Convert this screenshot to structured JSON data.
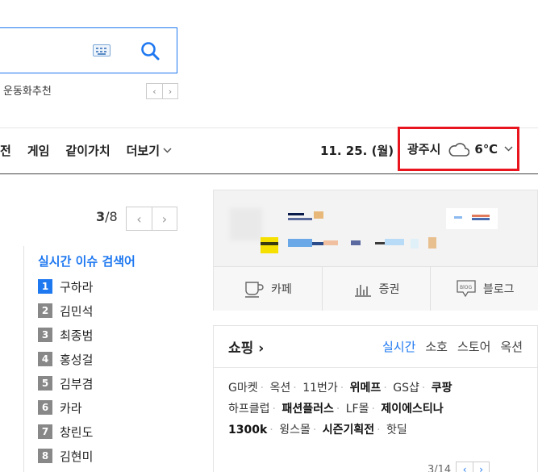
{
  "search": {
    "keyboard_icon": "keyboard-icon",
    "search_icon": "search-icon",
    "suggest_label": "운동화추천"
  },
  "nav": {
    "items": [
      "전",
      "게임",
      "같이가치",
      "더보기"
    ],
    "date": "11. 25. (월)",
    "weather": {
      "city": "광주시",
      "temp": "6℃",
      "icon": "cloud-icon"
    }
  },
  "realtime": {
    "page_current": "3",
    "page_total": "/8",
    "title": "실시간 이슈 검색어",
    "items": [
      {
        "rank": "1",
        "keyword": "구하라"
      },
      {
        "rank": "2",
        "keyword": "김민석"
      },
      {
        "rank": "3",
        "keyword": "최종범"
      },
      {
        "rank": "4",
        "keyword": "홍성걸"
      },
      {
        "rank": "5",
        "keyword": "김부겸"
      },
      {
        "rank": "6",
        "keyword": "카라"
      },
      {
        "rank": "7",
        "keyword": "창린도"
      },
      {
        "rank": "8",
        "keyword": "김현미"
      }
    ]
  },
  "services": [
    {
      "label": "카페",
      "icon": "cup-icon"
    },
    {
      "label": "증권",
      "icon": "chart-icon"
    },
    {
      "label": "블로그",
      "icon": "blog-icon"
    }
  ],
  "shopping": {
    "title": "쇼핑",
    "tabs": [
      "실시간",
      "소호",
      "스토어",
      "옥션"
    ],
    "links": [
      {
        "text": "G마켓",
        "strong": false
      },
      {
        "text": "옥션",
        "strong": false
      },
      {
        "text": "11번가",
        "strong": false
      },
      {
        "text": "위메프",
        "strong": true
      },
      {
        "text": "GS샵",
        "strong": false
      },
      {
        "text": "쿠팡",
        "strong": true
      },
      {
        "text": "하프클럽",
        "strong": false
      },
      {
        "text": "패션플러스",
        "strong": true
      },
      {
        "text": "LF몰",
        "strong": false
      },
      {
        "text": "제이에스티나",
        "strong": true
      },
      {
        "text": "1300k",
        "strong": true
      },
      {
        "text": "윙스몰",
        "strong": false
      },
      {
        "text": "시즌기획전",
        "strong": true
      },
      {
        "text": "핫딜",
        "strong": false
      }
    ],
    "page": "3/14"
  },
  "colors": {
    "accent": "#1e78f0",
    "highlight": "#e8151f"
  }
}
